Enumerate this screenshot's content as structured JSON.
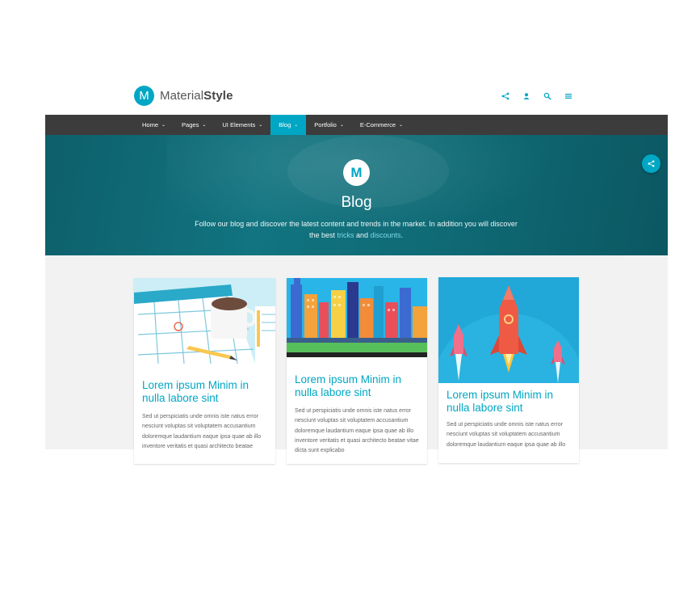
{
  "brand": {
    "logo_letter": "M",
    "name_light": "Material",
    "name_bold": "Style"
  },
  "header_icons": [
    "share-icon",
    "user-icon",
    "search-icon",
    "menu-icon"
  ],
  "nav": {
    "items": [
      {
        "label": "Home"
      },
      {
        "label": "Pages"
      },
      {
        "label": "UI Elements"
      },
      {
        "label": "Blog",
        "active": true
      },
      {
        "label": "Portfolio"
      },
      {
        "label": "E-Commerce"
      }
    ],
    "chevron": "⌄"
  },
  "hero": {
    "logo_letter": "M",
    "title": "Blog",
    "desc_part1": "Follow our blog and discover the latest content and trends in the market. In addition you will discover the best ",
    "desc_link1": "tricks",
    "desc_and": " and ",
    "desc_link2": "discounts",
    "desc_end": "."
  },
  "cards": [
    {
      "image": "calendar-coffee-illustration",
      "title": "Lorem ipsum Minim in nulla labore sint",
      "text": "Sed ut perspiciatis unde omnis iste natus error nesciunt voluptas sit voluptatem accusantium doloremque laudantium eaque ipsa quae ab illo inventore veritatis et quasi architecto beatae"
    },
    {
      "image": "city-skyline-illustration",
      "title": "Lorem ipsum Minim in nulla labore sint",
      "text": "Sed ut perspiciatis unde omnis iste natus error nesciunt voluptas sit voluptatem accusantium doloremque laudantium eaque ipsa quae ab illo inventore veritatis et quasi architecto beatae vitae dicta sunt explicabo"
    },
    {
      "image": "rocket-launch-illustration",
      "title": "Lorem ipsum Minim in nulla labore sint",
      "text": "Sed ut perspiciatis unde omnis iste natus error nesciunt voluptas sit voluptatem accusantium doloremque laudantium eaque ipsa quae ab illo"
    }
  ],
  "colors": {
    "accent": "#00a7c4",
    "nav_bg": "#3c3c3c",
    "hero_bg": "#117480",
    "content_bg": "#f2f2f2"
  }
}
